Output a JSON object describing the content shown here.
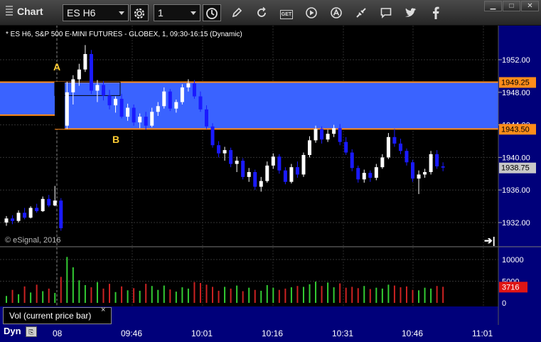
{
  "toolbar": {
    "window_title": "Chart",
    "symbol": "ES H6",
    "interval": "1",
    "icons": [
      "settings-gear-icon",
      "clock-icon",
      "pencil-icon",
      "refresh-icon",
      "get-icon",
      "play-icon",
      "alert-icon",
      "link-icon",
      "comment-icon",
      "twitter-icon",
      "facebook-icon"
    ],
    "get_label": "GET",
    "window_buttons": [
      "minimize",
      "maximize",
      "close"
    ]
  },
  "chart": {
    "info_line": "* ES H6, S&P 500 E-MINI FUTURES - GLOBEX, 1, 09:30-16:15 (Dynamic)",
    "copyright": "© eSignal, 2016",
    "annotations": [
      "A",
      "B"
    ],
    "colors": {
      "up": "#ffffff",
      "down": "#1a1aff",
      "zone": "#3a63ff",
      "level": "#ff8c1a",
      "panel": "#00007a"
    }
  },
  "volume_panel": {
    "label": "Vol (current price bar)",
    "close": "×",
    "current_value": "3716"
  },
  "footer": {
    "mode": "Dyn",
    "mode_icon": "chart-mode-icon"
  },
  "chart_data": {
    "type": "candlestick",
    "symbol": "ES H6",
    "interval_minutes": 1,
    "y_ticks": [
      "1952.00",
      "1948.00",
      "1944.00",
      "1940.00",
      "1936.00",
      "1932.00"
    ],
    "ylim": [
      1930,
      1955
    ],
    "x_ticks": [
      "08",
      "09:46",
      "10:01",
      "10:16",
      "10:31",
      "10:46",
      "11:01"
    ],
    "zone": {
      "top": 1949.25,
      "bottom": 1943.5,
      "top_label": "1949.25",
      "bottom_label": "1943.50"
    },
    "last_price": {
      "value": 1938.75,
      "label": "1938.75"
    },
    "volume_ticks": [
      "10000",
      "5000",
      "0"
    ],
    "volume_ylim": [
      0,
      10000
    ],
    "series": [
      {
        "name": "price",
        "candles": [
          [
            1932.0,
            1932.8,
            1931.6,
            1932.5
          ],
          [
            1932.5,
            1932.9,
            1931.8,
            1932.2
          ],
          [
            1932.2,
            1933.5,
            1932.0,
            1933.2
          ],
          [
            1933.2,
            1933.8,
            1932.4,
            1932.6
          ],
          [
            1932.6,
            1934.0,
            1932.5,
            1933.8
          ],
          [
            1933.8,
            1934.3,
            1933.2,
            1933.4
          ],
          [
            1933.4,
            1935.2,
            1933.3,
            1934.9
          ],
          [
            1934.9,
            1935.4,
            1933.9,
            1934.1
          ],
          [
            1934.1,
            1936.5,
            1934.0,
            1934.7
          ],
          [
            1934.7,
            1935.0,
            1931.0,
            1931.3
          ],
          [
            1943.9,
            1949.3,
            1943.5,
            1948.0
          ],
          [
            1948.0,
            1950.1,
            1946.5,
            1949.6
          ],
          [
            1949.6,
            1951.5,
            1948.8,
            1950.8
          ],
          [
            1950.8,
            1953.8,
            1950.5,
            1952.7
          ],
          [
            1952.7,
            1953.2,
            1947.8,
            1948.2
          ],
          [
            1948.2,
            1949.5,
            1946.8,
            1948.9
          ],
          [
            1948.9,
            1949.4,
            1947.0,
            1947.6
          ],
          [
            1947.6,
            1948.3,
            1945.9,
            1946.4
          ],
          [
            1946.4,
            1947.5,
            1945.5,
            1947.2
          ],
          [
            1947.2,
            1947.8,
            1944.8,
            1945.0
          ],
          [
            1945.0,
            1946.6,
            1944.5,
            1946.1
          ],
          [
            1946.1,
            1946.5,
            1943.9,
            1944.3
          ],
          [
            1944.3,
            1945.4,
            1943.6,
            1945.0
          ],
          [
            1945.0,
            1945.6,
            1943.4,
            1943.9
          ],
          [
            1943.9,
            1946.1,
            1943.7,
            1945.6
          ],
          [
            1945.6,
            1946.8,
            1945.1,
            1946.3
          ],
          [
            1946.3,
            1948.6,
            1946.0,
            1948.1
          ],
          [
            1948.1,
            1948.4,
            1945.7,
            1946.0
          ],
          [
            1946.0,
            1947.1,
            1945.5,
            1946.8
          ],
          [
            1946.8,
            1949.0,
            1946.5,
            1948.6
          ],
          [
            1948.6,
            1949.6,
            1948.1,
            1949.1
          ],
          [
            1949.1,
            1949.5,
            1947.2,
            1947.5
          ],
          [
            1947.5,
            1948.1,
            1945.6,
            1945.9
          ],
          [
            1945.9,
            1946.4,
            1943.5,
            1943.8
          ],
          [
            1943.8,
            1944.2,
            1941.2,
            1941.5
          ],
          [
            1941.5,
            1942.0,
            1940.0,
            1940.5
          ],
          [
            1940.5,
            1941.3,
            1939.6,
            1940.9
          ],
          [
            1940.9,
            1941.2,
            1938.8,
            1939.2
          ],
          [
            1939.2,
            1940.1,
            1938.2,
            1939.6
          ],
          [
            1939.6,
            1939.9,
            1937.3,
            1937.6
          ],
          [
            1937.6,
            1938.7,
            1937.0,
            1938.2
          ],
          [
            1938.2,
            1938.5,
            1936.0,
            1936.4
          ],
          [
            1936.4,
            1937.6,
            1935.8,
            1937.1
          ],
          [
            1937.1,
            1939.5,
            1936.9,
            1939.0
          ],
          [
            1939.0,
            1940.5,
            1938.6,
            1940.1
          ],
          [
            1940.1,
            1940.4,
            1938.0,
            1938.4
          ],
          [
            1938.4,
            1938.8,
            1936.7,
            1937.0
          ],
          [
            1937.0,
            1939.2,
            1936.8,
            1938.8
          ],
          [
            1938.8,
            1939.5,
            1937.5,
            1937.9
          ],
          [
            1937.9,
            1940.6,
            1937.6,
            1940.3
          ],
          [
            1940.3,
            1942.6,
            1940.0,
            1942.1
          ],
          [
            1942.1,
            1943.9,
            1941.8,
            1943.5
          ],
          [
            1943.5,
            1943.8,
            1941.7,
            1942.2
          ],
          [
            1942.2,
            1943.4,
            1941.9,
            1942.9
          ],
          [
            1942.9,
            1944.0,
            1942.5,
            1943.6
          ],
          [
            1943.6,
            1944.1,
            1941.5,
            1941.9
          ],
          [
            1941.9,
            1942.5,
            1940.3,
            1940.6
          ],
          [
            1940.6,
            1941.0,
            1938.3,
            1938.7
          ],
          [
            1938.7,
            1939.0,
            1936.9,
            1937.3
          ],
          [
            1937.3,
            1938.5,
            1936.9,
            1938.1
          ],
          [
            1938.1,
            1938.4,
            1937.0,
            1937.5
          ],
          [
            1937.5,
            1939.2,
            1937.2,
            1938.8
          ],
          [
            1938.8,
            1940.4,
            1938.6,
            1940.0
          ],
          [
            1940.0,
            1943.0,
            1939.8,
            1942.5
          ],
          [
            1942.5,
            1943.5,
            1941.3,
            1941.7
          ],
          [
            1941.7,
            1942.3,
            1940.4,
            1940.8
          ],
          [
            1940.8,
            1941.1,
            1939.0,
            1939.4
          ],
          [
            1939.4,
            1939.7,
            1937.0,
            1937.4
          ],
          [
            1937.4,
            1938.4,
            1935.5,
            1937.9
          ],
          [
            1937.9,
            1938.6,
            1937.5,
            1938.2
          ],
          [
            1938.2,
            1940.8,
            1937.9,
            1940.4
          ],
          [
            1940.4,
            1940.9,
            1938.6,
            1938.9
          ],
          [
            1938.9,
            1939.4,
            1938.3,
            1938.75
          ]
        ]
      }
    ],
    "volume": [
      1600,
      3000,
      2000,
      3800,
      2400,
      4200,
      2700,
      3300,
      2300,
      6000,
      10600,
      8200,
      5200,
      4100,
      3600,
      4800,
      3300,
      4400,
      2500,
      3800,
      2900,
      3400,
      2800,
      4400,
      3900,
      3000,
      4000,
      3100,
      2600,
      3600,
      3300,
      4800,
      4600,
      4200,
      3700,
      2800,
      3700,
      3300,
      4000,
      2700,
      3500,
      3000,
      2800,
      4100,
      3500,
      3000,
      3300,
      3600,
      3900,
      3700,
      4300,
      4900,
      3900,
      4700,
      3600,
      4500,
      3500,
      3700,
      3400,
      3900,
      3200,
      3500,
      3300,
      4200,
      4000,
      3600,
      3800,
      3000,
      2900,
      3500,
      3300,
      3900,
      3716
    ]
  }
}
